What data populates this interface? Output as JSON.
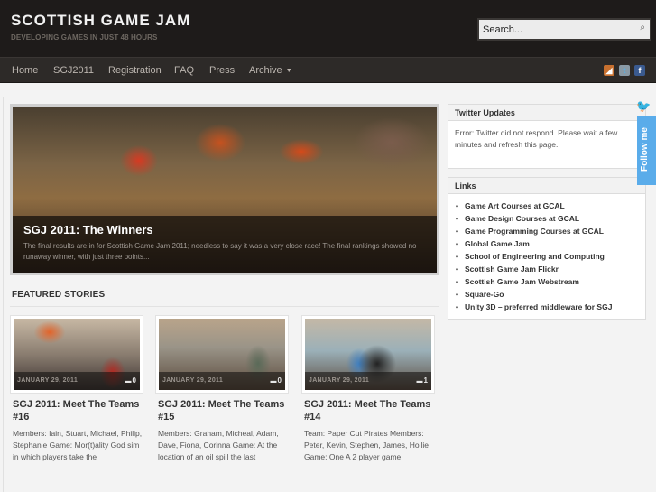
{
  "site": {
    "title": "SCOTTISH GAME JAM",
    "tagline": "DEVELOPING GAMES IN JUST 48 HOURS"
  },
  "search": {
    "placeholder": "Search...",
    "icon": "search-icon"
  },
  "nav": {
    "items": [
      {
        "label": "Home"
      },
      {
        "label": "SGJ2011"
      },
      {
        "label": "Registration"
      },
      {
        "label": "FAQ"
      },
      {
        "label": "Press"
      },
      {
        "label": "Archive",
        "has_dropdown": true
      }
    ],
    "social": [
      {
        "name": "rss",
        "icon": "rss-icon",
        "glyph": "◢",
        "color": "#c7702f"
      },
      {
        "name": "twitter",
        "icon": "twitter-icon",
        "glyph": "t",
        "color": "#8a9aa6"
      },
      {
        "name": "facebook",
        "icon": "facebook-icon",
        "glyph": "f",
        "color": "#3a5a8f"
      }
    ]
  },
  "slider": {
    "title": "SGJ 2011: The Winners",
    "excerpt": "The final results are in for Scottish Game Jam 2011; needless to say it was a very close race! The final rankings showed no runaway winner, with just three points..."
  },
  "featured": {
    "heading": "FEATURED STORIES",
    "cards": [
      {
        "date": "JANUARY 29, 2011",
        "comments": "0",
        "title": "SGJ 2011: Meet The Teams #16",
        "excerpt": "Members: Iain, Stuart, Michael, Philip, Stephanie Game: Mor(t)ality God sim in which players take the"
      },
      {
        "date": "JANUARY 29, 2011",
        "comments": "0",
        "title": "SGJ 2011: Meet The Teams #15",
        "excerpt": "Members: Graham, Micheal, Adam, Dave, Fiona, Corinna Game: At the location of an oil spill the last"
      },
      {
        "date": "JANUARY 29, 2011",
        "comments": "1",
        "title": "SGJ 2011: Meet The Teams #14",
        "excerpt": "Team: Paper Cut Pirates Members: Peter, Kevin, Stephen, James, Hollie Game: One A 2 player game"
      }
    ]
  },
  "sidebar": {
    "twitter": {
      "title": "Twitter Updates",
      "message": "Error: Twitter did not respond. Please wait a few minutes and refresh this page."
    },
    "links": {
      "title": "Links",
      "items": [
        "Game Art Courses at GCAL",
        "Game Design Courses at GCAL",
        "Game Programming Courses at GCAL",
        "Global Game Jam",
        "School of Engineering and Computing",
        "Scottish Game Jam Flickr",
        "Scottish Game Jam Webstream",
        "Square-Go",
        "Unity 3D – preferred middleware for SGJ"
      ]
    }
  },
  "follow": {
    "label": "Follow me",
    "color": "#5aacea"
  }
}
